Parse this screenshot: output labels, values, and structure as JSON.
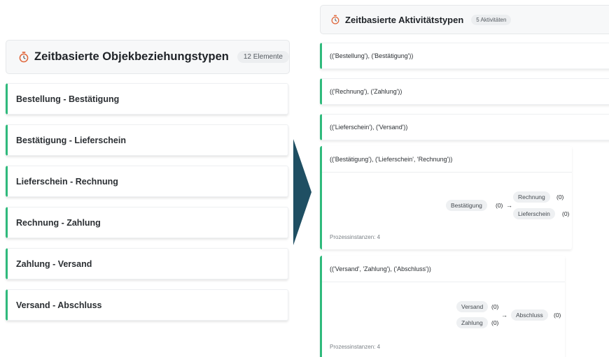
{
  "left_panel": {
    "title": "Zeitbasierte Objekbeziehungstypen",
    "badge": "12 Elemente",
    "items": [
      {
        "label": "Bestellung - Bestätigung"
      },
      {
        "label": "Bestätigung - Lieferschein"
      },
      {
        "label": "Lieferschein - Rechnung"
      },
      {
        "label": "Rechnung - Zahlung"
      },
      {
        "label": "Zahlung - Versand"
      },
      {
        "label": "Versand - Abschluss"
      }
    ]
  },
  "right_panel": {
    "title": "Zeitbasierte Aktivitätstypen",
    "badge": "5 Aktivitäten",
    "items": [
      {
        "label": "(('Bestellung'), ('Bestätigung'))"
      },
      {
        "label": "(('Rechnung'), ('Zahlung'))"
      },
      {
        "label": "(('Lieferschein'), ('Versand'))"
      }
    ],
    "cards": [
      {
        "label": "(('Bestätigung'), ('Lieferschein', 'Rechnung'))",
        "source_node": "Bestätigung",
        "source_count": "(0)",
        "arrow": "→",
        "target_nodes": [
          {
            "label": "Rechnung",
            "count": "(0)"
          },
          {
            "label": "Lieferschein",
            "count": "(0)"
          }
        ],
        "instances": "Prozessinstanzen: 4"
      },
      {
        "label": "(('Versand', 'Zahlung'), ('Abschluss'))",
        "source_nodes": [
          {
            "label": "Versand",
            "count": "(0)"
          },
          {
            "label": "Zahlung",
            "count": "(0)"
          }
        ],
        "arrow": "→",
        "target_node": "Abschluss",
        "target_count": "(0)",
        "instances": "Prozessinstanzen: 4"
      }
    ]
  },
  "colors": {
    "accent": "#2fba7c",
    "arrow_fill": "#1f4f63",
    "stopwatch": "#e0663a"
  },
  "icons": {
    "header_icon": "stopwatch-icon",
    "transition": "chevron-right-arrow-icon"
  }
}
